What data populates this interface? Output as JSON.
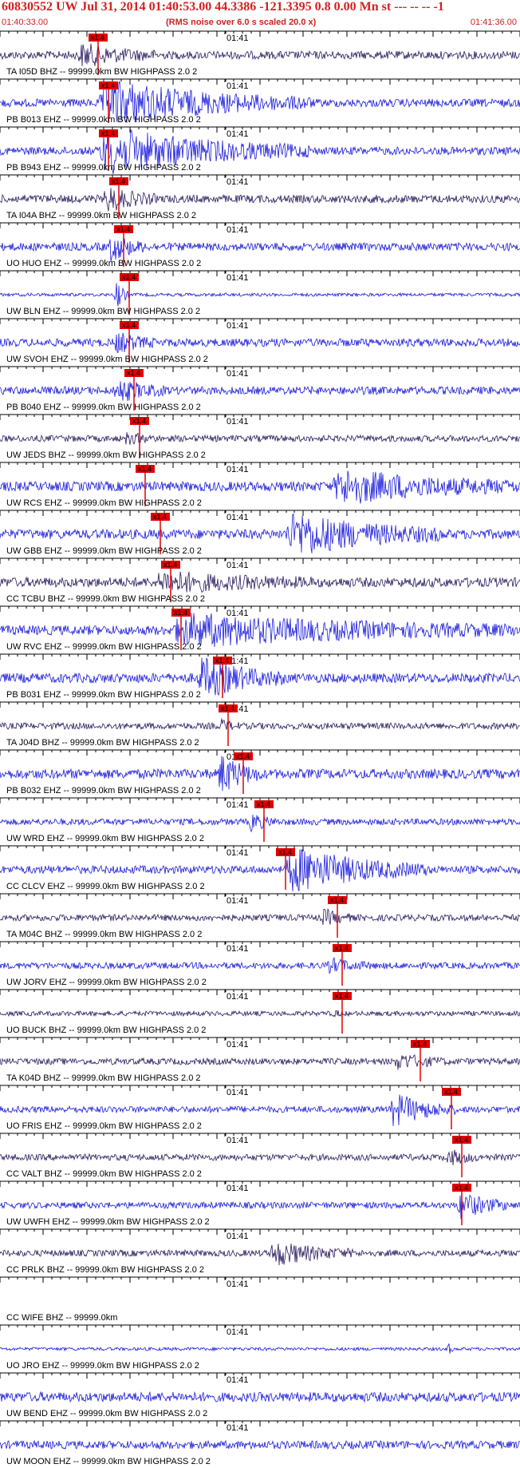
{
  "header": {
    "title": "60830552 UW Jul 31, 2014 01:40:53.00   44.3386 -121.3395  0.8 0.00 Mn st --- -- --  -1",
    "start_time": "01:40:33.00",
    "subtitle": "(RMS noise over 6.0 s scaled 20.0 x)",
    "end_time": "01:41:36.00"
  },
  "colors": {
    "header_text": "#d42020",
    "trace_blue": "#1a1adc",
    "trace_dark": "#2a1a5e",
    "pick": "#e00000",
    "axis": "#000000"
  },
  "time_tick_label": "01:41",
  "pick_label": "x1.4",
  "traces": [
    {
      "label": "TA I05D BHZ -- 99999.0km BW  HIGHPASS  2.0  2",
      "color": "dark",
      "amp": 5,
      "pick": 0.17,
      "event_start": 0.15,
      "event_end": 0.3,
      "event_amp": 14
    },
    {
      "label": "PB B013 EHZ -- 99999.0km BW  HIGHPASS  2.0  2",
      "color": "blue",
      "amp": 5,
      "pick": 0.19,
      "event_start": 0.19,
      "event_end": 0.6,
      "event_amp": 30
    },
    {
      "label": "PB B943 EHZ -- 99999.0km BW  HIGHPASS  2.0  2",
      "color": "blue",
      "amp": 5,
      "pick": 0.19,
      "event_start": 0.19,
      "event_end": 0.6,
      "event_amp": 30
    },
    {
      "label": "TA I04A BHZ -- 99999.0km BW  HIGHPASS  2.0  2",
      "color": "dark",
      "amp": 5,
      "pick": 0.21,
      "event_start": 0.2,
      "event_end": 0.3,
      "event_amp": 16
    },
    {
      "label": "UO HUO EHZ -- 99999.0km BW  HIGHPASS  2.0  2",
      "color": "blue",
      "amp": 5,
      "pick": 0.22,
      "event_start": 0.21,
      "event_end": 0.28,
      "event_amp": 18
    },
    {
      "label": "UW BLN EHZ -- 99999.0km BW  HIGHPASS  2.0  2",
      "color": "blue",
      "amp": 2,
      "pick": 0.23,
      "event_start": 0.22,
      "event_end": 0.25,
      "event_amp": 22
    },
    {
      "label": "UW SVOH EHZ -- 99999.0km BW  HIGHPASS  2.0  2",
      "color": "blue",
      "amp": 5,
      "pick": 0.23,
      "event_start": 0.22,
      "event_end": 0.3,
      "event_amp": 12
    },
    {
      "label": "PB B040 EHZ -- 99999.0km BW  HIGHPASS  2.0  2",
      "color": "blue",
      "amp": 5,
      "pick": 0.24,
      "event_start": 0.22,
      "event_end": 0.32,
      "event_amp": 14
    },
    {
      "label": "UW JEDS BHZ -- 99999.0km BW  HIGHPASS  2.0  2",
      "color": "dark",
      "amp": 4,
      "pick": 0.25,
      "event_start": 0.24,
      "event_end": 0.3,
      "event_amp": 6
    },
    {
      "label": "UW RCS EHZ -- 99999.0km BW  HIGHPASS  2.0  2",
      "color": "blue",
      "amp": 6,
      "pick": 0.26,
      "event_start": 0.64,
      "event_end": 1.0,
      "event_amp": 22
    },
    {
      "label": "UW GBB EHZ -- 99999.0km BW  HIGHPASS  2.0  2",
      "color": "blue",
      "amp": 6,
      "pick": 0.29,
      "event_start": 0.55,
      "event_end": 0.85,
      "event_amp": 28
    },
    {
      "label": "CC TCBU BHZ -- 99999.0km BW  HIGHPASS  2.0  2",
      "color": "dark",
      "amp": 6,
      "pick": 0.31,
      "event_start": 0.3,
      "event_end": 0.6,
      "event_amp": 12
    },
    {
      "label": "UW RVC EHZ -- 99999.0km BW  HIGHPASS  2.0  2",
      "color": "blue",
      "amp": 6,
      "pick": 0.33,
      "event_start": 0.33,
      "event_end": 1.0,
      "event_amp": 20
    },
    {
      "label": "PB B031 EHZ -- 99999.0km BW  HIGHPASS  2.0  2",
      "color": "blue",
      "amp": 6,
      "pick": 0.41,
      "event_start": 0.38,
      "event_end": 0.55,
      "event_amp": 26
    },
    {
      "label": "TA J04D BHZ -- 99999.0km BW  HIGHPASS  2.0  2",
      "color": "dark",
      "amp": 4,
      "pick": 0.42,
      "event_start": 0.42,
      "event_end": 0.46,
      "event_amp": 8
    },
    {
      "label": "PB B032 EHZ -- 99999.0km BW  HIGHPASS  2.0  2",
      "color": "blue",
      "amp": 6,
      "pick": 0.45,
      "event_start": 0.42,
      "event_end": 0.5,
      "event_amp": 26
    },
    {
      "label": "UW WRD EHZ -- 99999.0km BW  HIGHPASS  2.0  2",
      "color": "blue",
      "amp": 4,
      "pick": 0.49,
      "event_start": 0.48,
      "event_end": 0.53,
      "event_amp": 12
    },
    {
      "label": "CC CLCV EHZ -- 99999.0km BW  HIGHPASS  2.0  2",
      "color": "blue",
      "amp": 5,
      "pick": 0.53,
      "event_start": 0.55,
      "event_end": 0.82,
      "event_amp": 30
    },
    {
      "label": "TA M04C BHZ -- 99999.0km BW  HIGHPASS  2.0  2",
      "color": "dark",
      "amp": 4,
      "pick": 0.63,
      "event_start": 0.62,
      "event_end": 0.68,
      "event_amp": 10
    },
    {
      "label": "UW JORV EHZ -- 99999.0km BW  HIGHPASS  2.0  2",
      "color": "blue",
      "amp": 4,
      "pick": 0.64,
      "event_start": 0.63,
      "event_end": 0.72,
      "event_amp": 8
    },
    {
      "label": "UO BUCK BHZ -- 99999.0km BW  HIGHPASS  2.0  2",
      "color": "dark",
      "amp": 3,
      "pick": 0.64,
      "event_start": 0.64,
      "event_end": 0.66,
      "event_amp": 4
    },
    {
      "label": "TA K04D BHZ -- 99999.0km BW  HIGHPASS  2.0  2",
      "color": "dark",
      "amp": 4,
      "pick": 0.79,
      "event_start": 0.76,
      "event_end": 0.86,
      "event_amp": 10
    },
    {
      "label": "UO FRIS EHZ -- 99999.0km BW  HIGHPASS  2.0  2",
      "color": "blue",
      "amp": 4,
      "pick": 0.85,
      "event_start": 0.75,
      "event_end": 0.88,
      "event_amp": 22
    },
    {
      "label": "CC VALT BHZ -- 99999.0km BW  HIGHPASS  2.0  2",
      "color": "dark",
      "amp": 4,
      "pick": 0.87,
      "event_start": 0.86,
      "event_end": 0.92,
      "event_amp": 10
    },
    {
      "label": "UW UWFH EHZ -- 99999.0km BW  HIGHPASS  2.0  2",
      "color": "blue",
      "amp": 4,
      "pick": 0.87,
      "event_start": 0.88,
      "event_end": 0.98,
      "event_amp": 18
    },
    {
      "label": "CC PRLK BHZ -- 99999.0km BW  HIGHPASS  2.0  2",
      "color": "dark",
      "amp": 4,
      "pick": null,
      "event_start": 0.52,
      "event_end": 0.68,
      "event_amp": 16
    },
    {
      "label": "CC WIFE BHZ -- 99999.0km",
      "color": "none",
      "amp": 0,
      "pick": null,
      "event_start": null,
      "event_end": null,
      "event_amp": 0
    },
    {
      "label": "UO JRO EHZ -- 99999.0km BW  HIGHPASS  2.0  2",
      "color": "blue",
      "amp": 2,
      "pick": null,
      "event_start": 0.86,
      "event_end": 0.87,
      "event_amp": 12
    },
    {
      "label": "UW BEND EHZ -- 99999.0km BW  HIGHPASS  2.0  2",
      "color": "blue",
      "amp": 6,
      "pick": null,
      "event_start": null,
      "event_end": null,
      "event_amp": 0
    },
    {
      "label": "UW MOON EHZ -- 99999.0km BW  HIGHPASS  2.0  2",
      "color": "blue",
      "amp": 5,
      "pick": null,
      "event_start": null,
      "event_end": null,
      "event_amp": 0
    }
  ]
}
